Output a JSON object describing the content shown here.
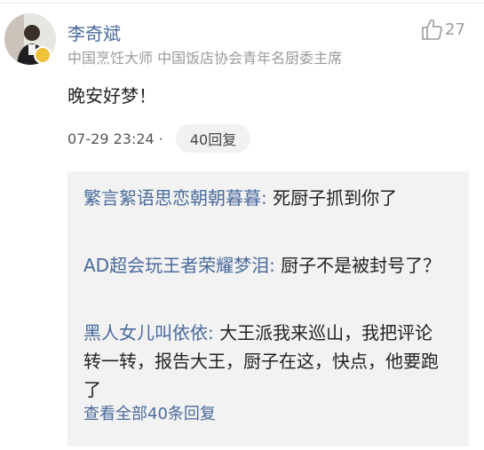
{
  "comment": {
    "author": "李奇斌",
    "author_title": "中国烹饪大师 中国饭店协会青年名厨委主席",
    "like_count": "27",
    "text": "晚安好梦！",
    "timestamp": "07-29 23:24 ·",
    "reply_count_label": "40回复"
  },
  "replies": [
    {
      "author": "繁言絮语思恋朝朝暮暮:",
      "text": " 死厨子抓到你了"
    },
    {
      "author": "AD超会玩王者荣耀梦泪:",
      "text": " 厨子不是被封号了？"
    },
    {
      "author": "黑人女儿叫依依:",
      "text": " 大王派我来巡山，我把评论转一转，报告大王，厨子在这，快点，他要跑了"
    }
  ],
  "view_all_label": "查看全部40条回复",
  "colors": {
    "link_blue": "#4a6a9c",
    "muted_gray": "#9a9a9a",
    "reply_bg": "#f2f2f2"
  }
}
